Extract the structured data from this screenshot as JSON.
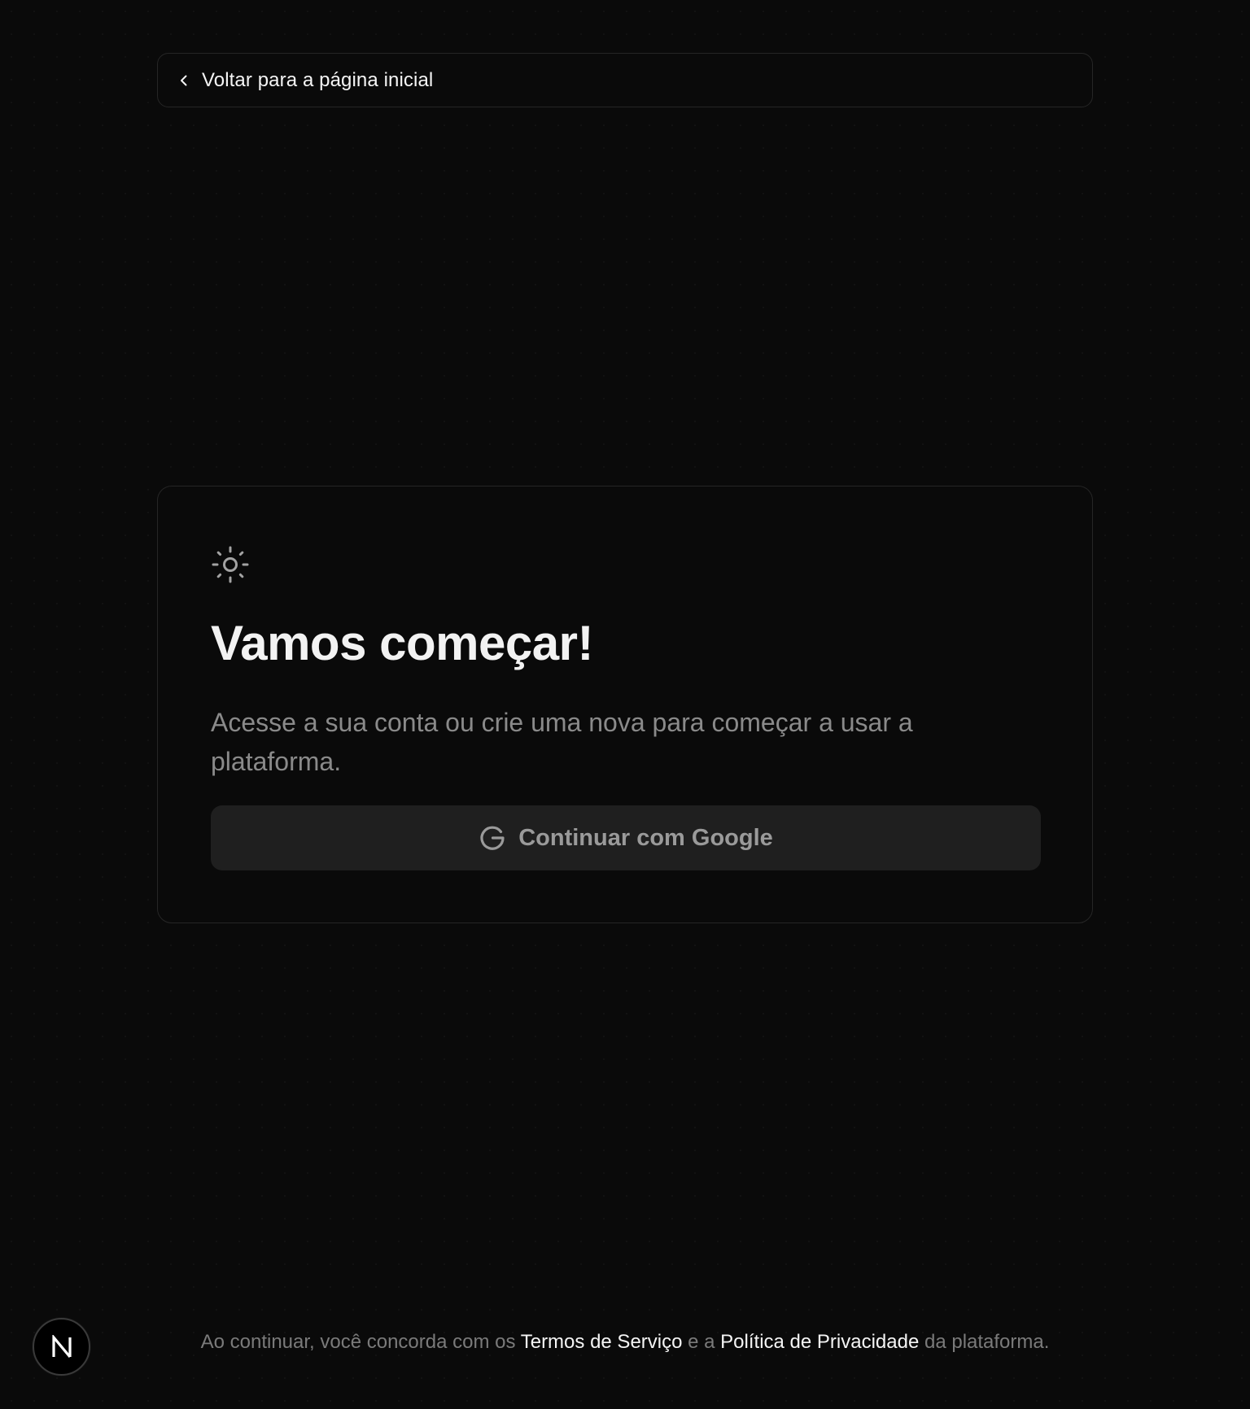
{
  "back_bar": {
    "label": "Voltar para a página inicial",
    "icon": "chevron-left-icon"
  },
  "card": {
    "icon": "sun-icon",
    "title": "Vamos começar!",
    "subtitle": "Acesse a sua conta ou crie uma nova para começar a usar a plataforma.",
    "google_button": {
      "icon": "google-icon",
      "label": "Continuar com Google"
    }
  },
  "footer": {
    "prefix": "Ao continuar, você concorda com os ",
    "terms_link": "Termos de Serviço",
    "middle": " e a ",
    "privacy_link": "Política de Privacidade",
    "suffix": " da plataforma."
  },
  "badge": {
    "icon": "n-logo-icon"
  },
  "colors": {
    "background": "#0a0a0a",
    "border": "#262626",
    "button_bg": "#1f1f1f",
    "text_primary": "#f5f5f5",
    "text_muted": "#8a8a8a"
  }
}
